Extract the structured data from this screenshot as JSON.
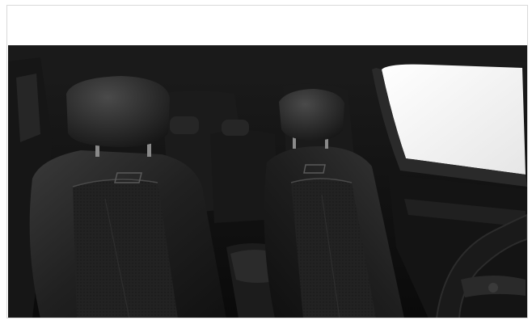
{
  "image": {
    "subject": "car-interior-front-seats",
    "colors": {
      "leather": "#1e1e1e",
      "leather_highlight": "#3a3a3a",
      "cabin_dark": "#0d0d0d",
      "window_light": "#f2f2f2",
      "accent_red": "#b3261e"
    }
  }
}
